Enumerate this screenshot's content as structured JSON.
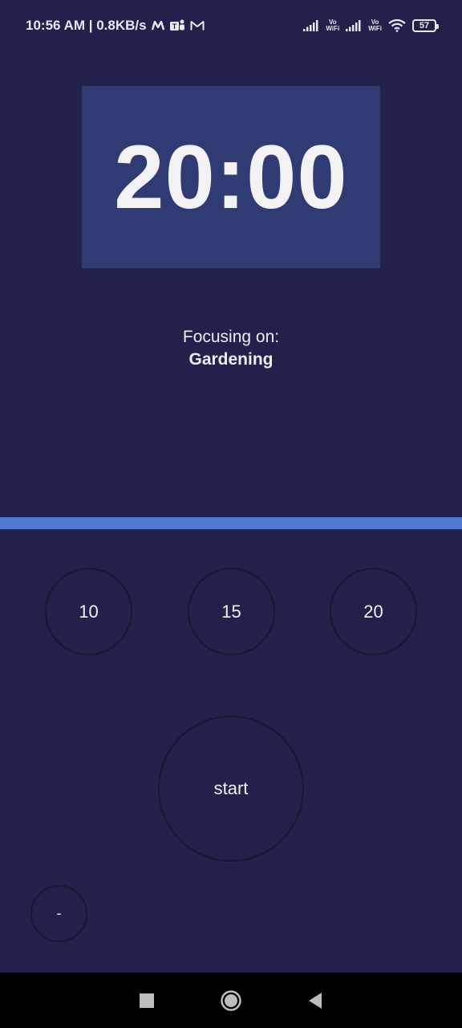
{
  "status_bar": {
    "time_speed": "10:56 AM | 0.8KB/s",
    "vowifi_label_1": "Vo\nWiFi",
    "vowifi_label_2": "Vo\nWiFi",
    "battery_level": "57"
  },
  "timer": {
    "display": "20:00"
  },
  "focus": {
    "label": "Focusing on:",
    "value": "Gardening"
  },
  "progress": {
    "fraction": 1.0,
    "color": "#5079d6"
  },
  "presets": [
    {
      "label": "10"
    },
    {
      "label": "15"
    },
    {
      "label": "20"
    }
  ],
  "controls": {
    "start_label": "start",
    "minus_label": "-"
  },
  "colors": {
    "background": "#22214b",
    "timer_box": "#303a73",
    "accent": "#5079d6"
  },
  "icons": {
    "nav_recents": "square-icon",
    "nav_home": "circle-home-icon",
    "nav_back": "triangle-back-icon"
  }
}
